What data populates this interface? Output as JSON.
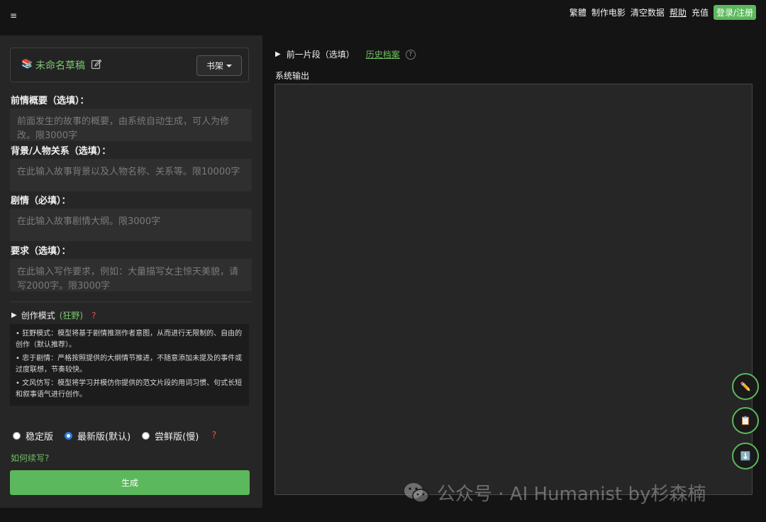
{
  "topbar": {
    "menu_icon": "hamburger-icon",
    "menu_glyph": "≡",
    "nav": [
      "繁體",
      "制作电影",
      "清空数据",
      "帮助",
      "充值"
    ],
    "login_label": "登录/注册"
  },
  "doc": {
    "icon": "books-icon",
    "title": "未命名草稿",
    "shelf_label": "书架"
  },
  "fields": {
    "prologue": {
      "label": "前情概要（选填）：",
      "placeholder": "前面发生的故事的概要，由系统自动生成，可人为修改。限3000字"
    },
    "background": {
      "label": "背景/人物关系（选填）：",
      "placeholder": "在此输入故事背景以及人物名称、关系等。限10000字"
    },
    "plot": {
      "label": "剧情（必填）：",
      "placeholder": "在此输入故事剧情大纲。限3000字"
    },
    "requirements": {
      "label": "要求（选填）：",
      "placeholder": "在此输入写作要求，例如：大量描写女主惊天美貌，请写2000字。限3000字"
    }
  },
  "mode": {
    "label": "创作模式",
    "value": "(狂野)",
    "help": "?",
    "descriptions": [
      "• 狂野模式：模型将基于剧情推测作者意图，从而进行无限制的、自由的创作（默认推荐）。",
      "• 忠于剧情：严格按照提供的大纲情节推进，不随意添加未提及的事件或过度联想，节奏较快。",
      "• 文风仿写：模型将学习并模仿你提供的范文片段的用词习惯、句式长短和叙事语气进行创作。"
    ]
  },
  "versions": {
    "options": [
      "稳定版",
      "最新版(默认)",
      "尝鲜版(慢)"
    ],
    "selected": "最新版(默认)",
    "help": "?"
  },
  "howto_label": "如何续写?",
  "generate_label": "生成",
  "right": {
    "prev_label": "前一片段（选填）",
    "history_label": "历史档案",
    "help": "?",
    "output_label": "系统输出"
  },
  "fabs": [
    "pencil-icon",
    "clipboard-icon",
    "download-icon"
  ],
  "watermark": "公众号 · AI Humanist by杉森楠",
  "colors": {
    "accent": "#5cb85c",
    "link": "#6fbf5f",
    "warning": "#d9534f",
    "background": "#141414",
    "panel": "#262626"
  }
}
